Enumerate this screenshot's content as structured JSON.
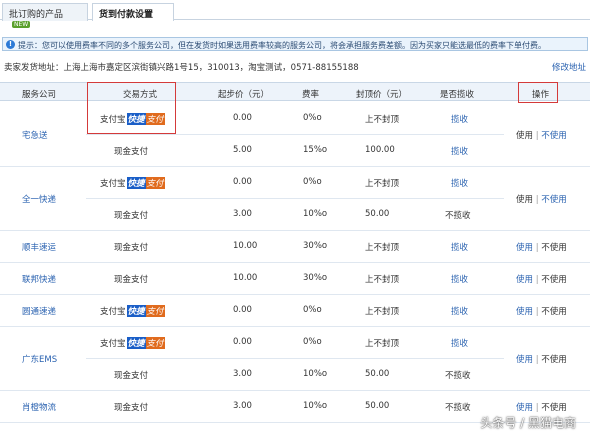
{
  "tabs": [
    {
      "label": "批订购的产品",
      "badge": "NEW"
    },
    {
      "label": "货到付款设置"
    }
  ],
  "tip": {
    "icon": "info-icon",
    "text": "提示：您可以使用费率不同的多个服务公司，但在发货时如果选用费率较高的服务公司，将会承担服务费差额。因为买家只能选最低的费率下单付费。"
  },
  "address": {
    "label": "卖家发货地址：上海上海市嘉定区滨街镇兴路1号15，310013，淘宝测试，0571-88155188",
    "modify": "修改地址"
  },
  "headers": {
    "company": "服务公司",
    "method": "交易方式",
    "start": "起步价（元）",
    "rate": "费率",
    "cap": "封顶价（元）",
    "collect": "是否揽收",
    "action": "操作"
  },
  "alipay_label": {
    "prefix": "支付宝",
    "fast": "快捷",
    "pay": "支付"
  },
  "cash_label": "现金支付",
  "companies": [
    {
      "name": "宅急送",
      "rows": [
        {
          "method": "alipay",
          "start": "0.00",
          "rate": "0%o",
          "cap": "上不封顶",
          "collect": "揽收"
        },
        {
          "method": "cash",
          "start": "5.00",
          "rate": "15%o",
          "cap": "100.00",
          "collect": "揽收"
        }
      ],
      "action_use": "使用",
      "action_no": "不使用"
    },
    {
      "name": "全一快递",
      "rows": [
        {
          "method": "alipay",
          "start": "0.00",
          "rate": "0%o",
          "cap": "上不封顶",
          "collect": "揽收"
        },
        {
          "method": "cash",
          "start": "3.00",
          "rate": "10%o",
          "cap": "50.00",
          "collect": "不揽收"
        }
      ],
      "action_use": "使用",
      "action_no": "不使用"
    },
    {
      "name": "顺丰速运",
      "rows": [
        {
          "method": "cash",
          "start": "10.00",
          "rate": "30%o",
          "cap": "上不封顶",
          "collect": "揽收"
        }
      ],
      "action_use": "使用",
      "action_no": "不使用"
    },
    {
      "name": "联邦快递",
      "rows": [
        {
          "method": "cash",
          "start": "10.00",
          "rate": "30%o",
          "cap": "上不封顶",
          "collect": "揽收"
        }
      ],
      "action_use": "使用",
      "action_no": "不使用"
    },
    {
      "name": "圆通速递",
      "rows": [
        {
          "method": "alipay",
          "start": "0.00",
          "rate": "0%o",
          "cap": "上不封顶",
          "collect": "揽收"
        }
      ],
      "action_use": "使用",
      "action_no": "不使用"
    },
    {
      "name": "广东EMS",
      "rows": [
        {
          "method": "alipay",
          "start": "0.00",
          "rate": "0%o",
          "cap": "上不封顶",
          "collect": "揽收"
        },
        {
          "method": "cash",
          "start": "3.00",
          "rate": "10%o",
          "cap": "50.00",
          "collect": "不揽收"
        }
      ],
      "action_use": "使用",
      "action_no": "不使用"
    },
    {
      "name": "肖橙物流",
      "rows": [
        {
          "method": "cash",
          "start": "3.00",
          "rate": "10%o",
          "cap": "50.00",
          "collect": "不揽收"
        }
      ],
      "action_use": "使用",
      "action_no": "不使用"
    }
  ],
  "watermark": "头条号 / 黑猫电商",
  "colors": {
    "link": "#2a62b0",
    "highlight": "#d43a3a",
    "header_bg": "#edf3fa",
    "alipay_blue": "#1a5ec7",
    "alipay_orange": "#e06b1e"
  }
}
